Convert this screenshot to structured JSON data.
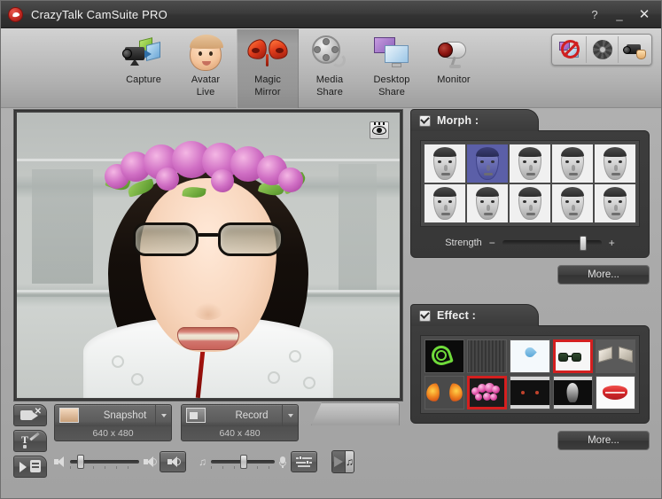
{
  "window": {
    "title": "CrazyTalk CamSuite PRO",
    "logo_icon": "crazytalk-logo-icon",
    "help_label": "?",
    "minimize_label": "_",
    "close_label": "✕"
  },
  "toolbar": {
    "items": [
      {
        "label": "Capture",
        "line2": "",
        "icon": "capture-icon",
        "active": false
      },
      {
        "label": "Avatar",
        "line2": "Live",
        "icon": "avatar-live-icon",
        "active": false
      },
      {
        "label": "Magic",
        "line2": "Mirror",
        "icon": "magic-mirror-icon",
        "active": true
      },
      {
        "label": "Media",
        "line2": "Share",
        "icon": "media-share-icon",
        "active": false
      },
      {
        "label": "Desktop",
        "line2": "Share",
        "icon": "desktop-share-icon",
        "active": false
      },
      {
        "label": "Monitor",
        "line2": "",
        "icon": "monitor-icon",
        "active": false
      }
    ],
    "utilities": [
      {
        "name": "disable-share-button",
        "icon": "no-share-icon"
      },
      {
        "name": "settings-button",
        "icon": "gear-icon"
      },
      {
        "name": "camera-setup-button",
        "icon": "camera-setup-icon"
      }
    ]
  },
  "video_preview": {
    "eye_toggle_icon": "eye-icon",
    "subject": "woman with flower-crown and sunglasses effects"
  },
  "side_buttons": [
    {
      "name": "video-off-button",
      "icon": "video-off-icon"
    },
    {
      "name": "text-tool-button",
      "icon": "text-pen-icon"
    },
    {
      "name": "emoticon-button",
      "icon": "emoticon-icon"
    }
  ],
  "capture_controls": {
    "snapshot": {
      "label": "Snapshot",
      "resolution": "640 x 480",
      "thumb_icon": "snapshot-thumb-icon",
      "dropdown_icon": "chevron-down-icon"
    },
    "record": {
      "label": "Record",
      "resolution": "640 x 480",
      "thumb_icon": "record-thumb-icon",
      "dropdown_icon": "chevron-down-icon"
    }
  },
  "audio_controls": {
    "volume": {
      "low_icon": "speaker-low-icon",
      "high_icon": "speaker-high-icon",
      "value_percent": 12,
      "mute_button_icon": "speaker-icon"
    },
    "music": {
      "note_icon": "music-note-icon",
      "mic_icon": "microphone-icon",
      "value_percent": 50,
      "mixer_button_icon": "audio-mixer-icon"
    },
    "player": {
      "play_icon": "play-icon",
      "playlist_icon": "music-note-icon"
    }
  },
  "morph_panel": {
    "title": "Morph :",
    "enabled": true,
    "strength_label": "Strength",
    "strength_percent": 80,
    "minus_label": "−",
    "plus_label": "+",
    "more_label": "More...",
    "selected_index": 1,
    "thumbnails": [
      {
        "name": "morph-thumb-1"
      },
      {
        "name": "morph-thumb-2"
      },
      {
        "name": "morph-thumb-3"
      },
      {
        "name": "morph-thumb-4"
      },
      {
        "name": "morph-thumb-5"
      },
      {
        "name": "morph-thumb-6"
      },
      {
        "name": "morph-thumb-7"
      },
      {
        "name": "morph-thumb-8"
      },
      {
        "name": "morph-thumb-9"
      },
      {
        "name": "morph-thumb-10"
      }
    ]
  },
  "effect_panel": {
    "title": "Effect :",
    "enabled": true,
    "more_label": "More...",
    "thumbnails": [
      {
        "name": "effect-swirl",
        "style": "fx-swirl",
        "selected": false
      },
      {
        "name": "effect-noise",
        "style": "fx-noise",
        "selected": false
      },
      {
        "name": "effect-waterdrop",
        "style": "fx-drop",
        "selected": false
      },
      {
        "name": "effect-sunglasses",
        "style": "fx-sun",
        "selected": true
      },
      {
        "name": "effect-paperfold",
        "style": "fx-fold",
        "selected": false
      },
      {
        "name": "effect-butterfly",
        "style": "fx-butterfly",
        "selected": false
      },
      {
        "name": "effect-flowers",
        "style": "fx-flowers",
        "selected": true
      },
      {
        "name": "effect-cateyes",
        "style": "fx-cat",
        "selected": false
      },
      {
        "name": "effect-ghost",
        "style": "fx-ghost",
        "selected": false
      },
      {
        "name": "effect-lips",
        "style": "fx-lips",
        "selected": false
      }
    ]
  },
  "colors": {
    "titlebar": "#3a3a3a",
    "app_background": "#adadad",
    "panel_dark": "#3d3d3d",
    "selection_blue": "#5b5fa8",
    "selection_red": "#d41f1f"
  }
}
